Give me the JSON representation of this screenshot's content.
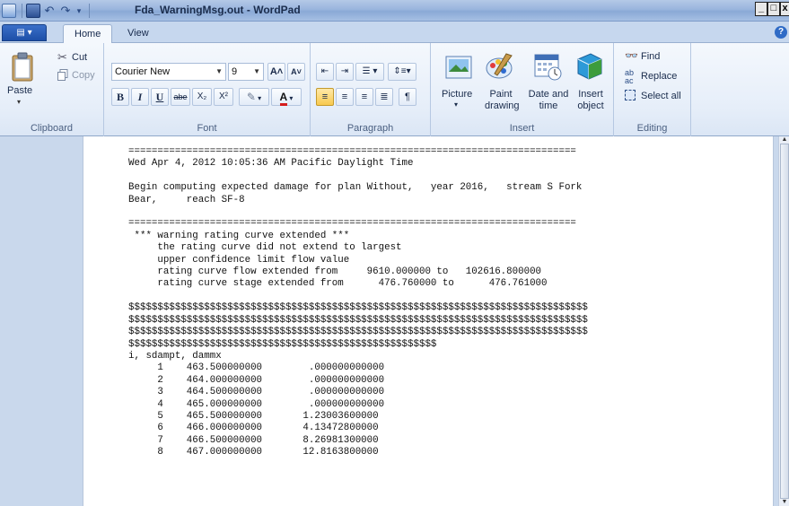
{
  "window": {
    "title": "Fda_WarningMsg.out - WordPad",
    "min": "_",
    "max": "□",
    "close": "x"
  },
  "tabs": {
    "app_menu": "▤ ▾",
    "home": "Home",
    "view": "View",
    "help": "?"
  },
  "clipboard": {
    "label": "Clipboard",
    "paste": "Paste",
    "cut": "Cut",
    "copy": "Copy"
  },
  "font": {
    "label": "Font",
    "family": "Courier New",
    "size": "9",
    "grow": "A˄",
    "shrink": "A˅",
    "bold": "B",
    "italic": "I",
    "underline": "U",
    "strike": "abe",
    "subscript": "X₂",
    "superscript": "X²",
    "highlight": "✎",
    "color": "A"
  },
  "paragraph": {
    "label": "Paragraph"
  },
  "insert": {
    "label": "Insert",
    "picture": "Picture",
    "paint_drawing": "Paint\ndrawing",
    "date_time": "Date and\ntime",
    "insert_object": "Insert\nobject"
  },
  "editing": {
    "label": "Editing",
    "find": "Find",
    "replace": "Replace",
    "select_all": "Select all"
  },
  "document": {
    "lines": [
      "=============================================================================",
      "Wed Apr 4, 2012 10:05:36 AM Pacific Daylight Time",
      "",
      "Begin computing expected damage for plan Without,   year 2016,   stream S Fork",
      "Bear,     reach SF-8",
      "",
      "=============================================================================",
      " *** warning rating curve extended ***",
      "     the rating curve did not extend to largest",
      "     upper confidence limit flow value",
      "     rating curve flow extended from     9610.000000 to   102616.800000",
      "     rating curve stage extended from      476.760000 to      476.761000",
      "",
      "$$$$$$$$$$$$$$$$$$$$$$$$$$$$$$$$$$$$$$$$$$$$$$$$$$$$$$$$$$$$$$$$$$$$$$$$$$$$$$$",
      "$$$$$$$$$$$$$$$$$$$$$$$$$$$$$$$$$$$$$$$$$$$$$$$$$$$$$$$$$$$$$$$$$$$$$$$$$$$$$$$",
      "$$$$$$$$$$$$$$$$$$$$$$$$$$$$$$$$$$$$$$$$$$$$$$$$$$$$$$$$$$$$$$$$$$$$$$$$$$$$$$$",
      "$$$$$$$$$$$$$$$$$$$$$$$$$$$$$$$$$$$$$$$$$$$$$$$$$$$$$",
      "i, sdampt, dammx",
      "     1    463.500000000        .000000000000",
      "     2    464.000000000        .000000000000",
      "     3    464.500000000        .000000000000",
      "     4    465.000000000        .000000000000",
      "     5    465.500000000       1.23003600000",
      "     6    466.000000000       4.13472800000",
      "     7    466.500000000       8.26981300000",
      "     8    467.000000000       12.8163800000"
    ]
  },
  "scrollbar": {
    "up": "▲",
    "down": "▼"
  }
}
